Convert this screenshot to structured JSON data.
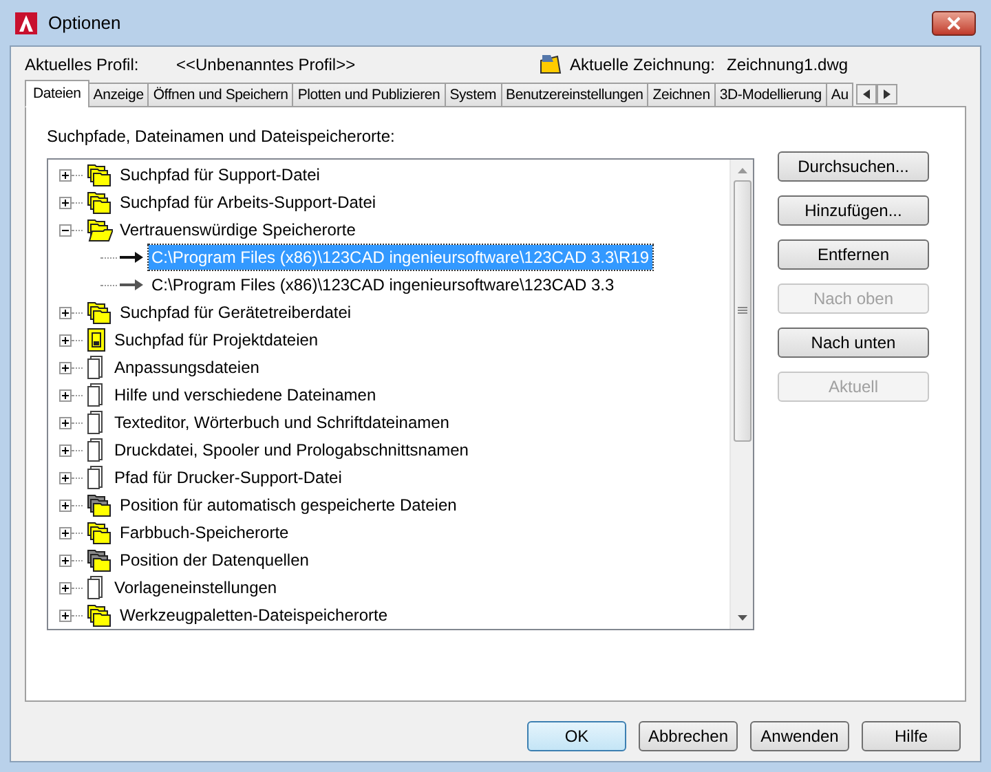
{
  "window": {
    "title": "Optionen"
  },
  "profile": {
    "label": "Aktuelles Profil:",
    "value": "<<Unbenanntes Profil>>"
  },
  "drawing": {
    "label": "Aktuelle Zeichnung:",
    "value": "Zeichnung1.dwg"
  },
  "tabs": [
    {
      "label": "Dateien",
      "selected": true
    },
    {
      "label": "Anzeige",
      "selected": false
    },
    {
      "label": "Öffnen und Speichern",
      "selected": false
    },
    {
      "label": "Plotten und Publizieren",
      "selected": false
    },
    {
      "label": "System",
      "selected": false
    },
    {
      "label": "Benutzereinstellungen",
      "selected": false
    },
    {
      "label": "Zeichnen",
      "selected": false
    },
    {
      "label": "3D-Modellierung",
      "selected": false
    },
    {
      "label": "Au",
      "selected": false
    }
  ],
  "section_label": "Suchpfade, Dateinamen und Dateispeicherorte:",
  "tree": [
    {
      "label": "Suchpfad für Support-Datei",
      "kind": "folders",
      "expanded": false
    },
    {
      "label": "Suchpfad für Arbeits-Support-Datei",
      "kind": "folders",
      "expanded": false
    },
    {
      "label": "Vertrauenswürdige Speicherorte",
      "kind": "folders-open",
      "expanded": true,
      "children": [
        {
          "label": "C:\\Program Files (x86)\\123CAD ingenieursoftware\\123CAD 3.3\\R19",
          "selected": true
        },
        {
          "label": "C:\\Program Files (x86)\\123CAD ingenieursoftware\\123CAD 3.3",
          "selected": false
        }
      ]
    },
    {
      "label": "Suchpfad für Gerätetreiberdatei",
      "kind": "folders",
      "expanded": false
    },
    {
      "label": "Suchpfad für Projektdateien",
      "kind": "project",
      "expanded": false
    },
    {
      "label": "Anpassungsdateien",
      "kind": "file",
      "expanded": false
    },
    {
      "label": "Hilfe und verschiedene Dateinamen",
      "kind": "file",
      "expanded": false
    },
    {
      "label": "Texteditor, Wörterbuch und Schriftdateinamen",
      "kind": "file",
      "expanded": false
    },
    {
      "label": "Druckdatei, Spooler und Prologabschnittsnamen",
      "kind": "file",
      "expanded": false
    },
    {
      "label": "Pfad für Drucker-Support-Datei",
      "kind": "file",
      "expanded": false
    },
    {
      "label": "Position für automatisch gespeicherte Dateien",
      "kind": "folders-gray",
      "expanded": false
    },
    {
      "label": "Farbbuch-Speicherorte",
      "kind": "folders",
      "expanded": false
    },
    {
      "label": "Position der Datenquellen",
      "kind": "folders-gray",
      "expanded": false
    },
    {
      "label": "Vorlageneinstellungen",
      "kind": "file",
      "expanded": false
    },
    {
      "label": "Werkzeugpaletten-Dateispeicherorte",
      "kind": "folders",
      "expanded": false
    }
  ],
  "side_buttons": [
    {
      "label": "Durchsuchen...",
      "disabled": false
    },
    {
      "label": "Hinzufügen...",
      "disabled": false
    },
    {
      "label": "Entfernen",
      "disabled": false
    },
    {
      "label": "Nach oben",
      "disabled": true
    },
    {
      "label": "Nach unten",
      "disabled": false
    },
    {
      "label": "Aktuell",
      "disabled": true
    }
  ],
  "footer_buttons": [
    {
      "label": "OK",
      "default": true
    },
    {
      "label": "Abbrechen",
      "default": false
    },
    {
      "label": "Anwenden",
      "default": false
    },
    {
      "label": "Hilfe",
      "default": false
    }
  ]
}
